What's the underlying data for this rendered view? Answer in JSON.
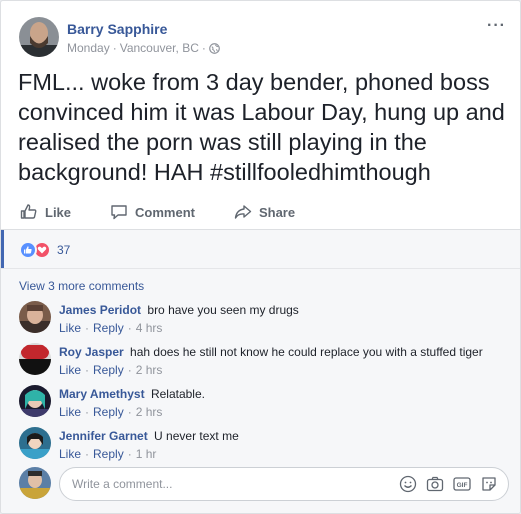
{
  "post": {
    "author": "Barry Sapphire",
    "time": "Monday",
    "separator": "·",
    "location": "Vancouver, BC",
    "separator2": "·",
    "more_icon": "···",
    "text": "FML... woke from 3 day bender, phoned boss convinced him it was Labour Day, hung up and realised the porn was still playing in the background! HAH #stillfooledhimthough"
  },
  "actions": {
    "like_label": "Like",
    "comment_label": "Comment",
    "share_label": "Share"
  },
  "reactions": {
    "count": "37",
    "types": [
      "like",
      "love"
    ],
    "colors": {
      "like": "#5890ff",
      "love": "#f25268"
    }
  },
  "comments": {
    "view_more": "View 3 more comments",
    "items": [
      {
        "author": "James Peridot",
        "text": "bro have you seen my drugs",
        "like": "Like",
        "reply": "Reply",
        "time": "4 hrs"
      },
      {
        "author": "Roy Jasper",
        "text": "hah does he still not know he could replace you with a stuffed tiger",
        "like": "Like",
        "reply": "Reply",
        "time": "2 hrs"
      },
      {
        "author": "Mary Amethyst",
        "text": "Relatable.",
        "like": "Like",
        "reply": "Reply",
        "time": "2 hrs"
      },
      {
        "author": "Jennifer Garnet",
        "text": "U never text me",
        "like": "Like",
        "reply": "Reply",
        "time": "1 hr"
      }
    ],
    "separator": "·"
  },
  "composer": {
    "placeholder": "Write a comment...",
    "icons": [
      "emoji-icon",
      "camera-icon",
      "gif-icon",
      "sticker-icon"
    ]
  },
  "colors": {
    "link": "#385898",
    "muted": "#90949c",
    "accent": "#4267b2"
  }
}
